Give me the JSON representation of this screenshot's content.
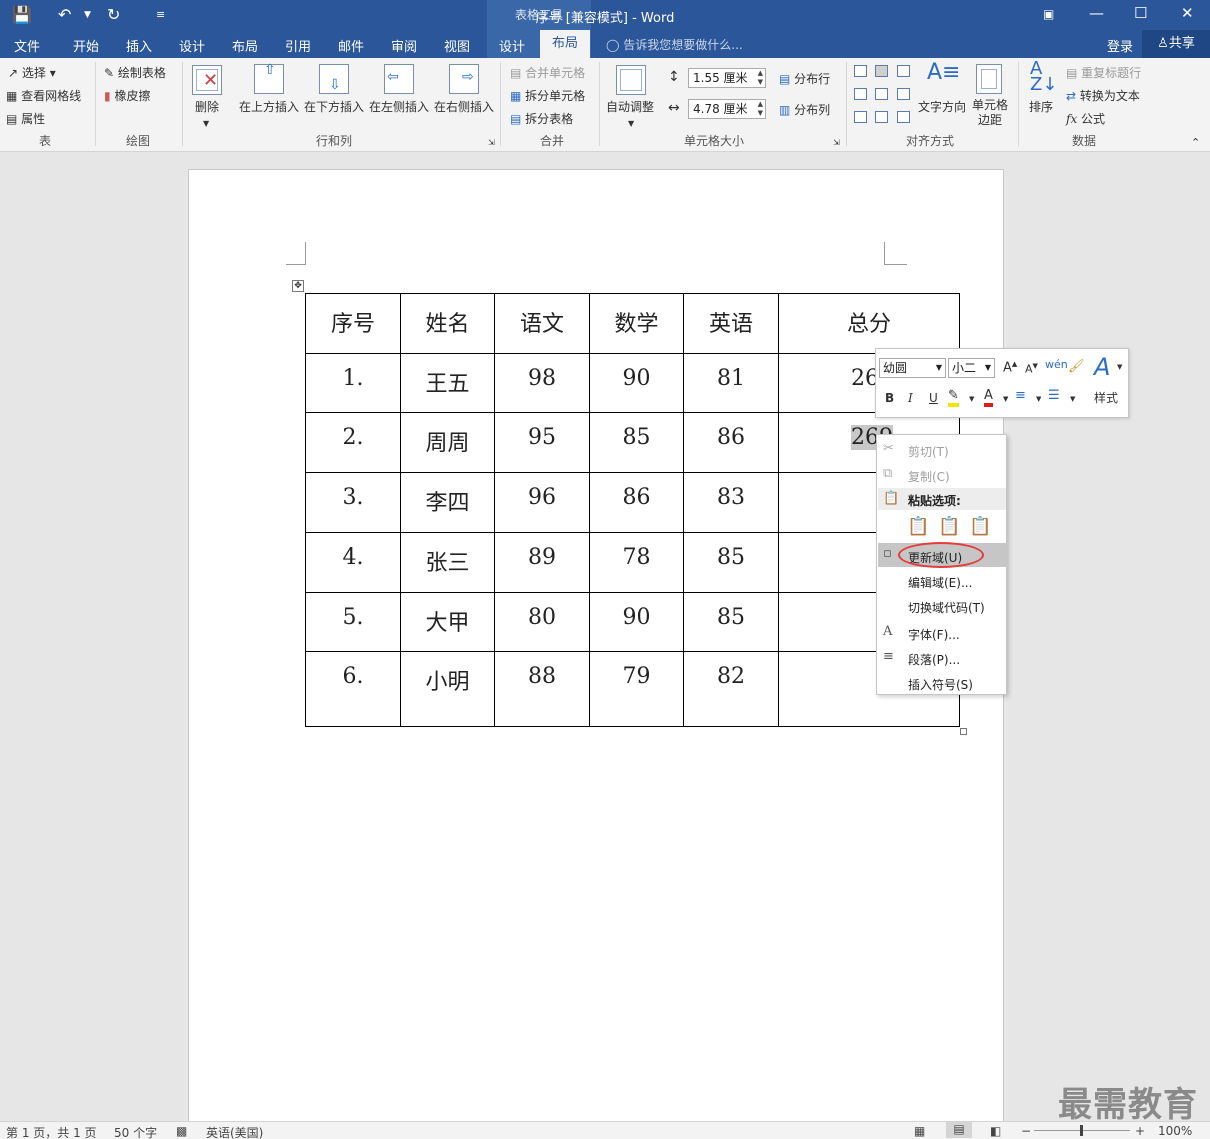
{
  "window": {
    "title": "序号 [兼容模式] - Word",
    "context_tab_group": "表格工具"
  },
  "tabs": [
    "文件",
    "开始",
    "插入",
    "设计",
    "布局",
    "引用",
    "邮件",
    "审阅",
    "视图",
    "设计",
    "布局"
  ],
  "tell_me": "告诉我您想要做什么...",
  "login": "登录",
  "share": "共享",
  "ribbon": {
    "table_group": {
      "select": "选择",
      "gridlines": "查看网格线",
      "properties": "属性",
      "label": "表"
    },
    "draw_group": {
      "draw_table": "绘制表格",
      "eraser": "橡皮擦",
      "label": "绘图"
    },
    "rows_cols": {
      "delete": "删除",
      "insert_above": "在上方插入",
      "insert_below": "在下方插入",
      "insert_left": "在左侧插入",
      "insert_right": "在右侧插入",
      "label": "行和列"
    },
    "merge": {
      "merge_cells": "合并单元格",
      "split_cells": "拆分单元格",
      "split_table": "拆分表格",
      "label": "合并"
    },
    "cell_size": {
      "autofit": "自动调整",
      "height": "1.55 厘米",
      "width": "4.78 厘米",
      "distribute_rows": "分布行",
      "distribute_cols": "分布列",
      "label": "单元格大小"
    },
    "alignment": {
      "text_direction": "文字方向",
      "cell_margins": "单元格\n边距",
      "label": "对齐方式"
    },
    "data": {
      "sort": "排序",
      "repeat_header": "重复标题行",
      "convert_text": "转换为文本",
      "formula": "公式",
      "label": "数据"
    }
  },
  "table": {
    "headers": [
      "序号",
      "姓名",
      "语文",
      "数学",
      "英语",
      "总分"
    ],
    "rows": [
      [
        "1.",
        "王五",
        "98",
        "90",
        "81",
        "26"
      ],
      [
        "2.",
        "周周",
        "95",
        "85",
        "86",
        "269"
      ],
      [
        "3.",
        "李四",
        "96",
        "86",
        "83",
        ""
      ],
      [
        "4.",
        "张三",
        "89",
        "78",
        "85",
        ""
      ],
      [
        "5.",
        "大甲",
        "80",
        "90",
        "85",
        ""
      ],
      [
        "6.",
        "小明",
        "88",
        "79",
        "82",
        ""
      ]
    ]
  },
  "mini_toolbar": {
    "font": "幼圆",
    "size": "小二",
    "bold": "B",
    "italic": "I",
    "underline": "U",
    "styles": "样式"
  },
  "context_menu": {
    "cut": "剪切(T)",
    "copy": "复制(C)",
    "paste_options": "粘贴选项:",
    "update_field": "更新域(U)",
    "edit_field": "编辑域(E)...",
    "toggle_field_codes": "切换域代码(T)",
    "font": "字体(F)...",
    "paragraph": "段落(P)...",
    "insert_symbol": "插入符号(S)"
  },
  "status_bar": {
    "page": "第 1 页，共 1 页",
    "words": "50 个字",
    "language": "英语(美国)",
    "zoom": "100%"
  },
  "watermark": "最需教育",
  "colors": {
    "brand": "#2b579a",
    "highlight_oval": "#e53c3c"
  }
}
